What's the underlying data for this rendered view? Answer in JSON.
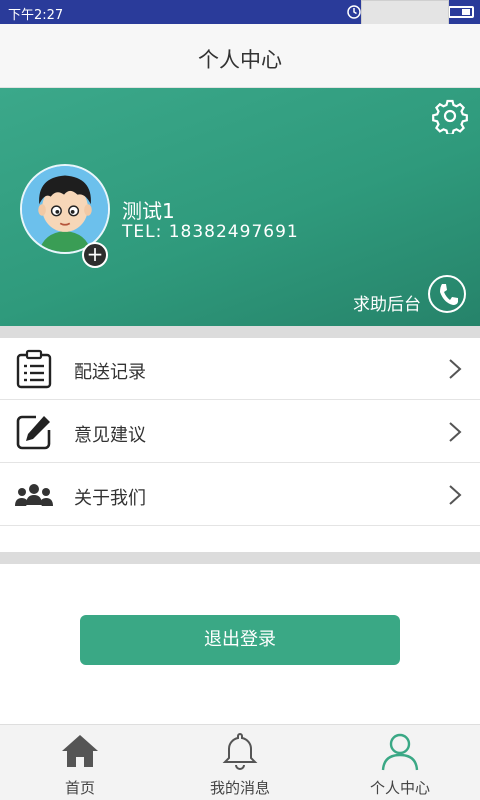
{
  "status_bar": {
    "time": "下午2:27"
  },
  "title_bar": {
    "title": "个人中心"
  },
  "profile": {
    "name": "测试1",
    "tel": "TEL:  18382497691",
    "help_label": "求助后台"
  },
  "menu": {
    "items": [
      {
        "label": "配送记录",
        "icon": "clipboard-list-icon"
      },
      {
        "label": "意见建议",
        "icon": "edit-icon"
      },
      {
        "label": "关于我们",
        "icon": "people-group-icon"
      }
    ]
  },
  "logout_label": "退出登录",
  "tabs": [
    {
      "label": "首页",
      "icon": "home-icon",
      "active": false
    },
    {
      "label": "我的消息",
      "icon": "bell-icon",
      "active": false
    },
    {
      "label": "个人中心",
      "icon": "person-icon",
      "active": true
    }
  ],
  "colors": {
    "status_bar": "#2a3b9a",
    "header_green": "#2f9a7c",
    "accent": "#3aa885"
  }
}
